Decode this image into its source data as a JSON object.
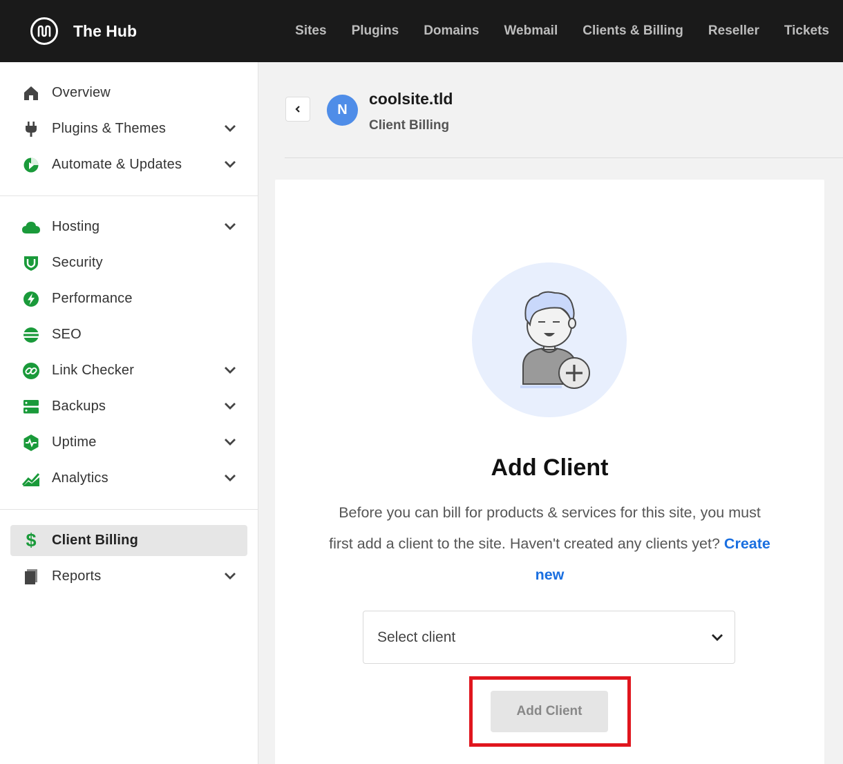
{
  "app": {
    "title": "The Hub"
  },
  "topnav": [
    "Sites",
    "Plugins",
    "Domains",
    "Webmail",
    "Clients & Billing",
    "Reseller",
    "Tickets"
  ],
  "sidebar": {
    "groups": [
      [
        {
          "label": "Overview",
          "icon": "home-icon"
        },
        {
          "label": "Plugins & Themes",
          "icon": "plug-icon",
          "expandable": true
        },
        {
          "label": "Automate & Updates",
          "icon": "automate-icon",
          "expandable": true
        }
      ],
      [
        {
          "label": "Hosting",
          "icon": "cloud-icon",
          "expandable": true
        },
        {
          "label": "Security",
          "icon": "shield-icon"
        },
        {
          "label": "Performance",
          "icon": "bolt-icon"
        },
        {
          "label": "SEO",
          "icon": "seo-icon"
        },
        {
          "label": "Link Checker",
          "icon": "link-icon",
          "expandable": true
        },
        {
          "label": "Backups",
          "icon": "server-icon",
          "expandable": true
        },
        {
          "label": "Uptime",
          "icon": "heartbeat-icon",
          "expandable": true
        },
        {
          "label": "Analytics",
          "icon": "chart-icon",
          "expandable": true
        }
      ],
      [
        {
          "label": "Client Billing",
          "icon": "dollar-icon",
          "active": true
        },
        {
          "label": "Reports",
          "icon": "document-icon",
          "expandable": true
        }
      ]
    ]
  },
  "site": {
    "avatar_letter": "N",
    "name": "coolsite.tld",
    "section": "Client Billing"
  },
  "card": {
    "title": "Add Client",
    "description": "Before you can bill for products & services for this site, you must first add a client to the site. Haven't created any clients yet?",
    "link": "Create new",
    "select_value": "Select client",
    "button": "Add Client"
  },
  "colors": {
    "accent_green": "#1a9a3a",
    "link_blue": "#1a6fe0",
    "avatar_blue": "#4f8de8",
    "highlight_red": "#e0161e"
  }
}
